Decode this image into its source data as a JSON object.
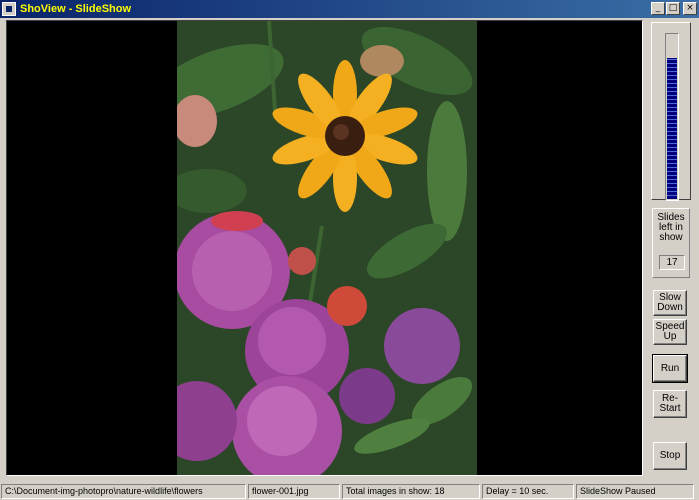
{
  "window": {
    "title": "ShoView - SlideShow",
    "minimize_glyph": "_",
    "maximize_glyph": "□",
    "close_glyph": "×"
  },
  "viewer": {
    "photo_icon": "flower-photo"
  },
  "sidepanel": {
    "speed_meter_fraction": 0.86,
    "slides_left_label": "Slides left in show",
    "slides_left_count": "17",
    "buttons": {
      "slow_down": "Slow Down",
      "speed_up": "Speed Up",
      "run": "Run",
      "restart": "Re-Start",
      "stop": "Stop"
    }
  },
  "statusbar": {
    "path": "C:\\Document-img-photopro\\nature-wildlife\\flowers",
    "filename": "flower-001.jpg",
    "total_images": "Total images in show: 18",
    "delay": "Delay = 10 sec.",
    "state": "SlideShow Paused"
  },
  "colors": {
    "titlebar_start": "#0a246a",
    "titlebar_end": "#3a6ea5",
    "title_text": "#ffff00",
    "meter_fill": "#00007f"
  }
}
